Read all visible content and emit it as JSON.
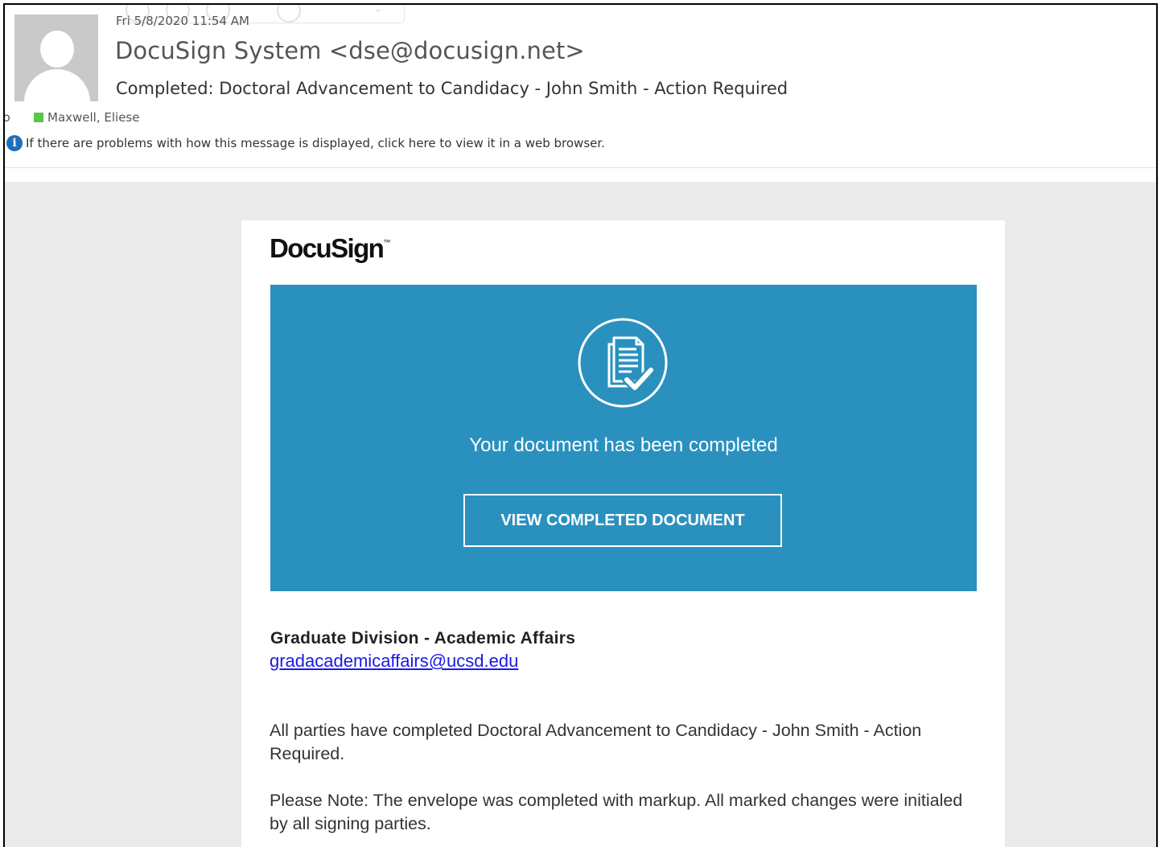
{
  "email_header": {
    "date": "Fri 5/8/2020 11:54 AM",
    "sender": "DocuSign System <dse@docusign.net>",
    "subject": "Completed: Doctoral Advancement to Candidacy - John Smith - Action Required",
    "to_label": "To",
    "recipient": "Maxwell, Eliese",
    "presence_color": "#5cc44c",
    "info_icon": "info-icon",
    "info_text": "If there are problems with how this message is displayed, click here to view it in a web browser."
  },
  "email_body": {
    "logo_text": "DocuSign",
    "logo_mark": "™",
    "banner_color": "#2a91bf",
    "banner_icon": "document-check-icon",
    "banner_text": "Your document has been completed",
    "view_button_label": "VIEW COMPLETED DOCUMENT",
    "org_name": "Graduate Division - Academic Affairs",
    "org_email": "gradacademicaffairs@ucsd.edu",
    "paragraph_1": "All parties have completed Doctoral Advancement to Candidacy - John Smith - Action Required.",
    "paragraph_2": "Please Note: The envelope was completed with markup. All marked changes were initialed by all signing parties."
  }
}
